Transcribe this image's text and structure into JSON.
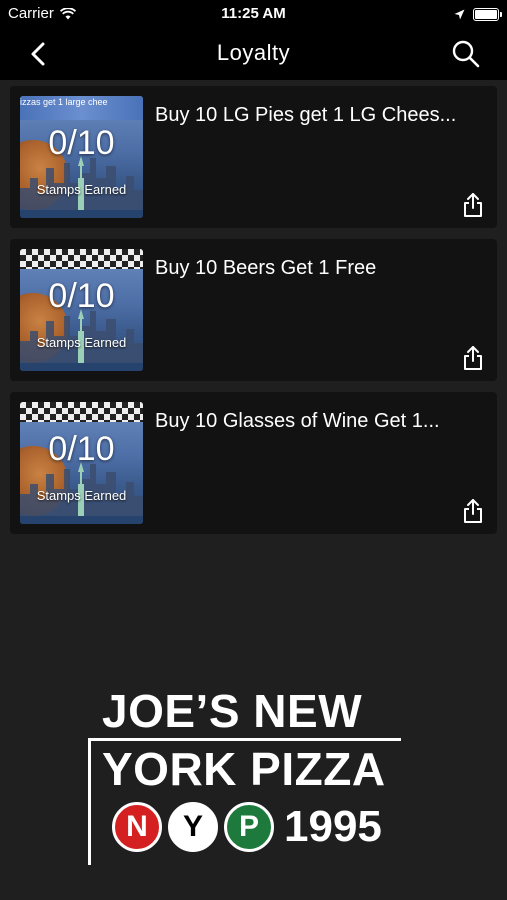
{
  "status_bar": {
    "carrier": "Carrier",
    "time": "11:25 AM"
  },
  "nav": {
    "title": "Loyalty"
  },
  "rewards": [
    {
      "title": "Buy 10 LG Pies get 1 LG Chees...",
      "stamps": "0/10",
      "stamps_label": "Stamps Earned",
      "banner": "izzas get 1 large chee"
    },
    {
      "title": "Buy 10 Beers Get 1 Free",
      "stamps": "0/10",
      "stamps_label": "Stamps Earned",
      "banner": ""
    },
    {
      "title": "Buy 10 Glasses of Wine Get 1...",
      "stamps": "0/10",
      "stamps_label": "Stamps Earned",
      "banner": ""
    }
  ],
  "logo": {
    "line1": "JOE’S NEW",
    "line2": "YORK PIZZA",
    "badges": [
      "N",
      "Y",
      "P"
    ],
    "year": "1995"
  },
  "icons": {
    "back": "chevron-left-icon",
    "search": "search-icon",
    "share": "share-icon",
    "wifi": "wifi-icon",
    "location": "location-arrow-icon",
    "battery": "battery-icon"
  },
  "colors": {
    "background": "#1f1f1f",
    "bar": "#000000",
    "card": "#121212",
    "badge_red": "#d42020",
    "badge_green": "#1e7a3c"
  }
}
